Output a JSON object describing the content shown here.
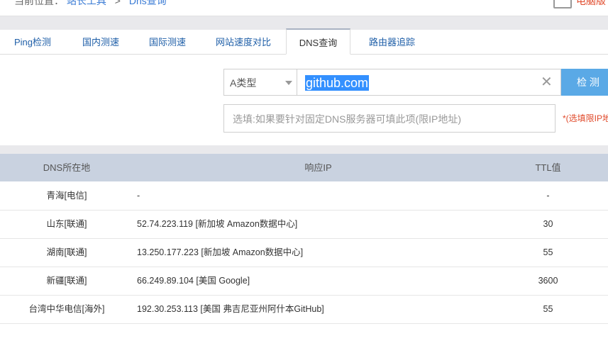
{
  "breadcrumb": {
    "prefix": "当前位置：",
    "home": "站长工具",
    "separator": ">",
    "current": "Dns查询",
    "right_text": "电脑版"
  },
  "tabs": [
    {
      "label": "Ping检测"
    },
    {
      "label": "国内测速"
    },
    {
      "label": "国际测速"
    },
    {
      "label": "网站速度对比"
    },
    {
      "label": "DNS查询",
      "active": true
    },
    {
      "label": "路由器追踪"
    }
  ],
  "query": {
    "record_type": "A类型",
    "domain": "github.com",
    "clear_icon": "close-icon",
    "submit_label": "检 测",
    "dns_placeholder": "选填:如果要针对固定DNS服务器可填此项(限IP地址)",
    "dns_hint": "*(选填限IP地址)"
  },
  "table": {
    "headers": [
      "DNS所在地",
      "响应IP",
      "TTL值"
    ],
    "rows": [
      {
        "location": "青海[电信]",
        "ip": "-",
        "ttl": "-"
      },
      {
        "location": "山东[联通]",
        "ip": "52.74.223.119 [新加坡 Amazon数据中心]",
        "ttl": "30"
      },
      {
        "location": "湖南[联通]",
        "ip": "13.250.177.223 [新加坡 Amazon数据中心]",
        "ttl": "55"
      },
      {
        "location": "新疆[联通]",
        "ip": "66.249.89.104 [美国 Google]",
        "ttl": "3600"
      },
      {
        "location": "台湾中华电信[海外]",
        "ip": "192.30.253.113 [美国 弗吉尼亚州阿什本GitHub]",
        "ttl": "55"
      }
    ]
  },
  "colors": {
    "accent_blue": "#5aa9e6",
    "link_blue": "#1f5fa8",
    "hint_red": "#e0492a",
    "header_bg": "#c9d2e0"
  }
}
